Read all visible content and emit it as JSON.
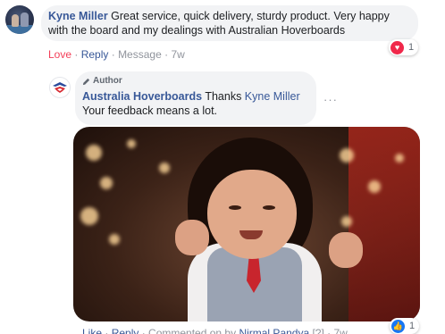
{
  "comment": {
    "author": "Kyne Miller",
    "text": "Great service, quick delivery, sturdy product. Very happy with the board and my dealings with Australian Hoverboards",
    "actions": {
      "love": "Love",
      "sep1": " · ",
      "reply": "Reply",
      "sep2": " · ",
      "message": "Message",
      "sep3": " · ",
      "time": "7w"
    },
    "reaction": {
      "icon": "heart-icon",
      "count": "1"
    }
  },
  "reply": {
    "author_badge": "Author",
    "author": "Australia Hoverboards",
    "text_prefix": "Thanks ",
    "mention": "Kyne Miller",
    "text_line2": "Your feedback means a lot.",
    "more": "···",
    "actions": {
      "like": "Like",
      "sep1": " · ",
      "reply": "Reply",
      "sep2": " · ",
      "commented": "Commented on by ",
      "commenter": "Nirmal Pandya",
      "edit_marker": " [?]",
      "sep3": " · ",
      "time": "7w"
    },
    "reaction": {
      "icon": "thumbs-up-icon",
      "count": "1"
    }
  },
  "colors": {
    "link": "#385898",
    "love": "#f33e58",
    "bubble": "#f2f3f5"
  }
}
